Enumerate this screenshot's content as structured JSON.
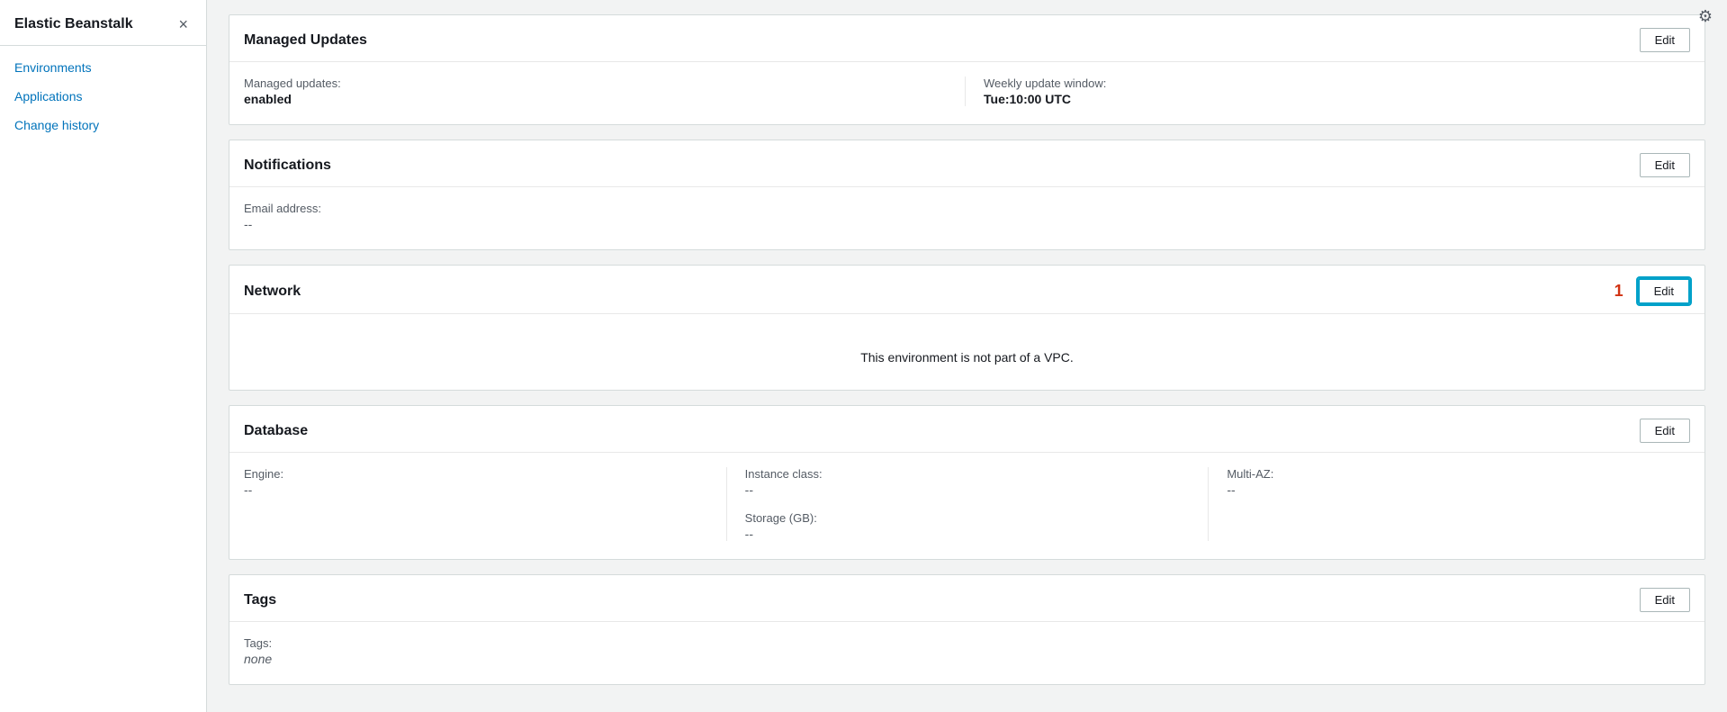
{
  "sidebar": {
    "title": "Elastic Beanstalk",
    "close_label": "×",
    "nav_items": [
      {
        "id": "environments",
        "label": "Environments"
      },
      {
        "id": "applications",
        "label": "Applications"
      },
      {
        "id": "change-history",
        "label": "Change history"
      }
    ]
  },
  "sections": {
    "managed_updates": {
      "title": "Managed Updates",
      "edit_label": "Edit",
      "fields": [
        {
          "label": "Managed updates:",
          "value": "enabled"
        },
        {
          "label": "Weekly update window:",
          "value": "Tue:10:00 UTC"
        }
      ]
    },
    "notifications": {
      "title": "Notifications",
      "edit_label": "Edit",
      "fields": [
        {
          "label": "Email address:",
          "value": "--"
        }
      ]
    },
    "network": {
      "title": "Network",
      "edit_label": "Edit",
      "highlight_number": "1",
      "message": "This environment is not part of a VPC."
    },
    "database": {
      "title": "Database",
      "edit_label": "Edit",
      "columns": [
        {
          "fields": [
            {
              "label": "Engine:",
              "value": "--"
            }
          ]
        },
        {
          "fields": [
            {
              "label": "Instance class:",
              "value": "--"
            },
            {
              "label": "Storage (GB):",
              "value": "--"
            }
          ]
        },
        {
          "fields": [
            {
              "label": "Multi-AZ:",
              "value": "--"
            }
          ]
        }
      ]
    },
    "tags": {
      "title": "Tags",
      "edit_label": "Edit",
      "fields": [
        {
          "label": "Tags:",
          "value": "none"
        }
      ]
    }
  },
  "icons": {
    "close": "×",
    "settings": "⚙"
  }
}
